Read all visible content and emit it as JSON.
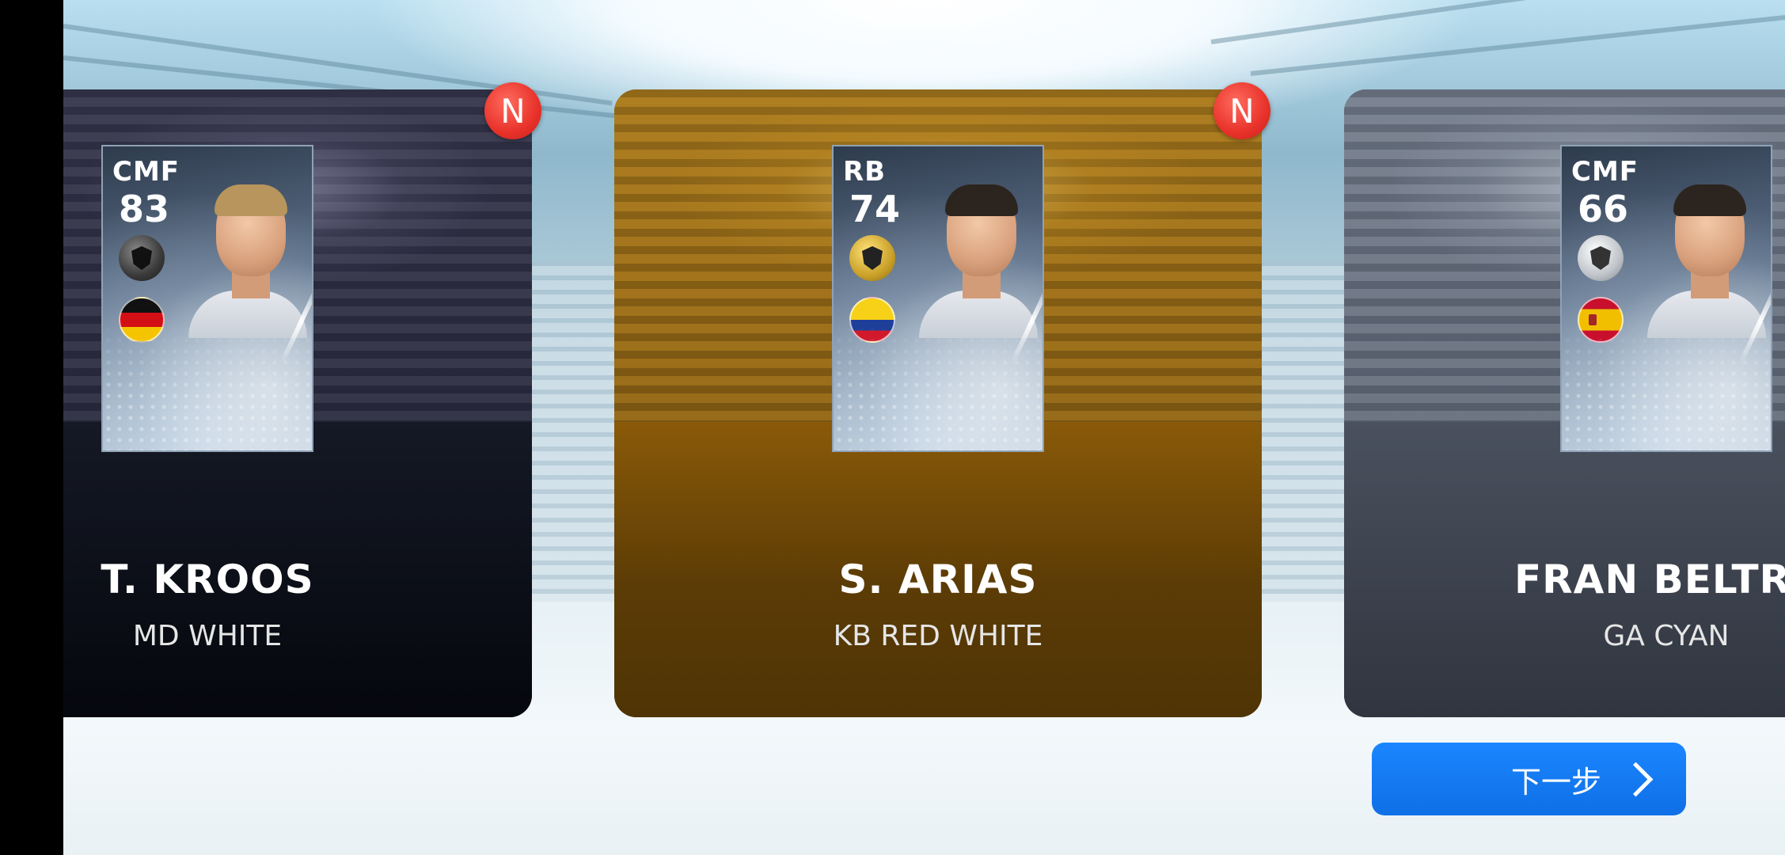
{
  "screen": {
    "next_button_label": "下一步",
    "colors": {
      "accent_blue": "#1177f2",
      "new_badge_red": "#e8322a",
      "card_dark": "#0a0e18",
      "card_gold": "#8a5a08",
      "card_grey": "#3b414d"
    }
  },
  "cards": [
    {
      "position": "CMF",
      "rating": "83",
      "player_name": "T. KROOS",
      "team": "MD WHITE",
      "new_badge": "N",
      "flag_icon": "germany-flag-icon",
      "badge_icon": "black-ball-badge-icon",
      "selected": false
    },
    {
      "position": "RB",
      "rating": "74",
      "player_name": "S. ARIAS",
      "team": "KB RED WHITE",
      "new_badge": "N",
      "flag_icon": "colombia-flag-icon",
      "badge_icon": "gold-ball-badge-icon",
      "selected": true
    },
    {
      "position": "CMF",
      "rating": "66",
      "player_name": "FRAN BELTRÁ",
      "team": "GA CYAN",
      "flag_icon": "spain-flag-icon",
      "badge_icon": "silver-ball-badge-icon",
      "selected": false
    }
  ]
}
